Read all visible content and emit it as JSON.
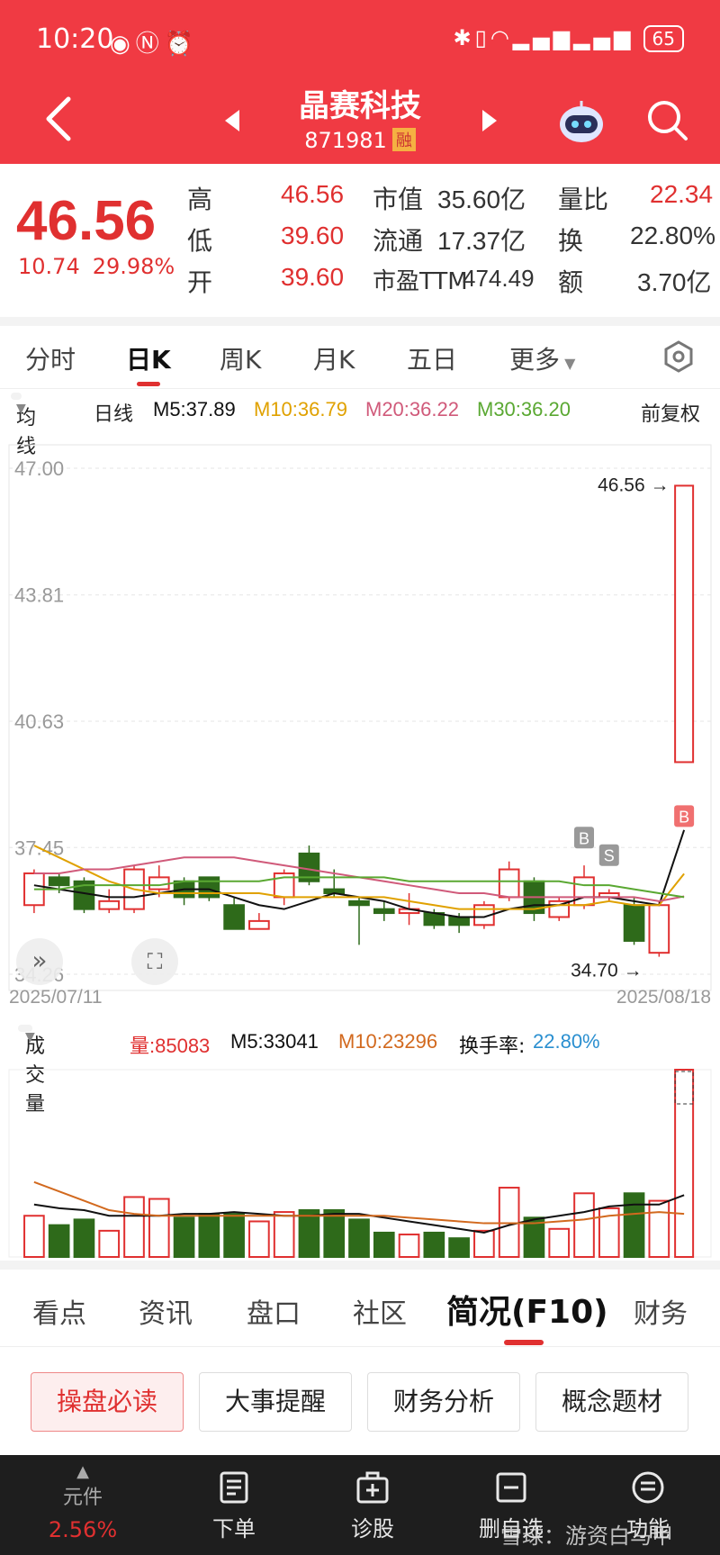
{
  "status_bar": {
    "time": "10:20",
    "battery": "65"
  },
  "header": {
    "stock_name": "晶赛科技",
    "stock_code": "871981",
    "badge": "融"
  },
  "quote": {
    "price": "46.56",
    "change_abs": "10.74",
    "change_pct": "29.98%",
    "rows": [
      {
        "l1": "高",
        "v1": "46.56",
        "l2": "市值",
        "v2": "35.60亿",
        "l3": "量比",
        "v3": "22.34"
      },
      {
        "l1": "低",
        "v1": "39.60",
        "l2": "流通",
        "v2": "17.37亿",
        "l3": "换",
        "v3": "22.80%"
      },
      {
        "l1": "开",
        "v1": "39.60",
        "l2": "市盈TTM",
        "v2": "474.49",
        "l3": "额",
        "v3": "3.70亿"
      }
    ]
  },
  "period_tabs": [
    "分时",
    "日K",
    "周K",
    "月K",
    "五日",
    "更多"
  ],
  "ma": {
    "btn": "均线",
    "kind": "日线",
    "m5": "M5:37.89",
    "m10": "M10:36.79",
    "m20": "M20:36.22",
    "m30": "M30:36.20",
    "adjust": "前复权"
  },
  "chart_data": [
    {
      "type": "candlestick",
      "ylim": [
        34.26,
        47.0
      ],
      "y_ticks": [
        "47.00",
        "43.81",
        "40.63",
        "37.45",
        "34.26"
      ],
      "x_labels": [
        "2025/07/11",
        "2025/08/18"
      ],
      "max_label": "46.56",
      "min_label": "34.70",
      "markers": [
        "B",
        "S",
        "B"
      ],
      "candles": [
        {
          "o": 36.0,
          "c": 36.8,
          "h": 36.9,
          "l": 35.8
        },
        {
          "o": 36.7,
          "c": 36.5,
          "h": 36.8,
          "l": 36.3
        },
        {
          "o": 36.6,
          "c": 35.9,
          "h": 36.7,
          "l": 35.8
        },
        {
          "o": 35.9,
          "c": 36.1,
          "h": 36.4,
          "l": 35.8
        },
        {
          "o": 35.9,
          "c": 36.9,
          "h": 37.0,
          "l": 35.8
        },
        {
          "o": 36.4,
          "c": 36.7,
          "h": 37.0,
          "l": 36.2
        },
        {
          "o": 36.6,
          "c": 36.2,
          "h": 36.7,
          "l": 36.0
        },
        {
          "o": 36.7,
          "c": 36.2,
          "h": 36.7,
          "l": 36.1
        },
        {
          "o": 36.0,
          "c": 35.4,
          "h": 36.2,
          "l": 35.4
        },
        {
          "o": 35.4,
          "c": 35.6,
          "h": 35.8,
          "l": 35.4
        },
        {
          "o": 36.2,
          "c": 36.8,
          "h": 36.9,
          "l": 36.0
        },
        {
          "o": 37.3,
          "c": 36.6,
          "h": 37.5,
          "l": 36.5
        },
        {
          "o": 36.4,
          "c": 36.3,
          "h": 36.9,
          "l": 36.2
        },
        {
          "o": 36.1,
          "c": 36.0,
          "h": 36.2,
          "l": 35.0
        },
        {
          "o": 35.9,
          "c": 35.8,
          "h": 36.1,
          "l": 35.6
        },
        {
          "o": 35.8,
          "c": 35.9,
          "h": 36.3,
          "l": 35.5
        },
        {
          "o": 35.8,
          "c": 35.5,
          "h": 35.9,
          "l": 35.4
        },
        {
          "o": 35.7,
          "c": 35.5,
          "h": 35.8,
          "l": 35.3
        },
        {
          "o": 35.5,
          "c": 36.0,
          "h": 36.1,
          "l": 35.4
        },
        {
          "o": 36.2,
          "c": 36.9,
          "h": 37.1,
          "l": 36.1
        },
        {
          "o": 36.6,
          "c": 35.8,
          "h": 36.7,
          "l": 35.6
        },
        {
          "o": 35.7,
          "c": 36.1,
          "h": 36.2,
          "l": 35.6
        },
        {
          "o": 36.0,
          "c": 36.7,
          "h": 37.0,
          "l": 35.9
        },
        {
          "o": 36.2,
          "c": 36.3,
          "h": 36.4,
          "l": 36.1
        },
        {
          "o": 36.0,
          "c": 35.1,
          "h": 36.2,
          "l": 35.0
        },
        {
          "o": 34.8,
          "c": 36.0,
          "h": 36.1,
          "l": 34.7
        },
        {
          "o": 39.6,
          "c": 46.56,
          "h": 46.56,
          "l": 39.6
        }
      ],
      "series": [
        {
          "name": "M5",
          "color": "#111111",
          "values": [
            36.5,
            36.4,
            36.3,
            36.2,
            36.2,
            36.3,
            36.4,
            36.4,
            36.2,
            36.0,
            35.9,
            36.1,
            36.3,
            36.2,
            36.1,
            35.9,
            35.8,
            35.7,
            35.7,
            35.9,
            36.0,
            36.0,
            36.2,
            36.2,
            36.1,
            36.0,
            37.89
          ]
        },
        {
          "name": "M10",
          "color": "#e0a100",
          "values": [
            37.5,
            37.2,
            36.9,
            36.6,
            36.4,
            36.3,
            36.3,
            36.3,
            36.3,
            36.3,
            36.2,
            36.2,
            36.2,
            36.2,
            36.2,
            36.1,
            36.0,
            35.9,
            35.9,
            35.9,
            35.9,
            36.0,
            36.0,
            36.1,
            36.0,
            36.0,
            36.79
          ]
        },
        {
          "name": "M20",
          "color": "#d05a7a",
          "values": [
            36.8,
            36.8,
            36.9,
            36.9,
            37.0,
            37.1,
            37.2,
            37.2,
            37.2,
            37.1,
            37.0,
            36.9,
            36.8,
            36.7,
            36.6,
            36.5,
            36.4,
            36.3,
            36.3,
            36.2,
            36.2,
            36.2,
            36.2,
            36.2,
            36.2,
            36.1,
            36.22
          ]
        },
        {
          "name": "M30",
          "color": "#5aa832",
          "values": [
            36.4,
            36.4,
            36.5,
            36.5,
            36.5,
            36.5,
            36.6,
            36.6,
            36.6,
            36.6,
            36.7,
            36.7,
            36.7,
            36.7,
            36.7,
            36.6,
            36.6,
            36.6,
            36.6,
            36.6,
            36.6,
            36.6,
            36.5,
            36.5,
            36.4,
            36.3,
            36.2
          ]
        }
      ]
    },
    {
      "type": "bar",
      "title": "成交量",
      "volumes": [
        22,
        17,
        20,
        14,
        32,
        31,
        21,
        23,
        23,
        19,
        24,
        25,
        25,
        20,
        13,
        12,
        13,
        10,
        14,
        37,
        21,
        15,
        34,
        26,
        34,
        30,
        100
      ],
      "m5": [
        28,
        26,
        25,
        22,
        22,
        22,
        23,
        23,
        24,
        23,
        22,
        22,
        23,
        23,
        21,
        19,
        17,
        15,
        13,
        17,
        20,
        22,
        24,
        27,
        28,
        28,
        33
      ],
      "m10": [
        40,
        35,
        30,
        25,
        23,
        22,
        22,
        22,
        22,
        22,
        22,
        22,
        22,
        22,
        22,
        21,
        20,
        19,
        18,
        18,
        18,
        19,
        20,
        22,
        23,
        24,
        23
      ],
      "vol_btn": "成交量",
      "vol": "量:85083",
      "m5_label": "M5:33041",
      "m10_label": "M10:23296",
      "turnover_label": "换手率:",
      "turnover_value": "22.80%"
    }
  ],
  "info_tabs": [
    "看点",
    "资讯",
    "盘口",
    "社区",
    "简况(F10)",
    "财务"
  ],
  "buttons": [
    "操盘必读",
    "大事提醒",
    "财务分析",
    "概念题材"
  ],
  "bottom_nav": {
    "fund_label": "元件",
    "fund_pct": "2.56%",
    "items": [
      "下单",
      "诊股",
      "删自选",
      "功能"
    ],
    "watermark": "雪球：游资白马甲"
  },
  "colors": {
    "up": "#e03030",
    "down": "#2e6a1a",
    "header": "#f03a43"
  }
}
